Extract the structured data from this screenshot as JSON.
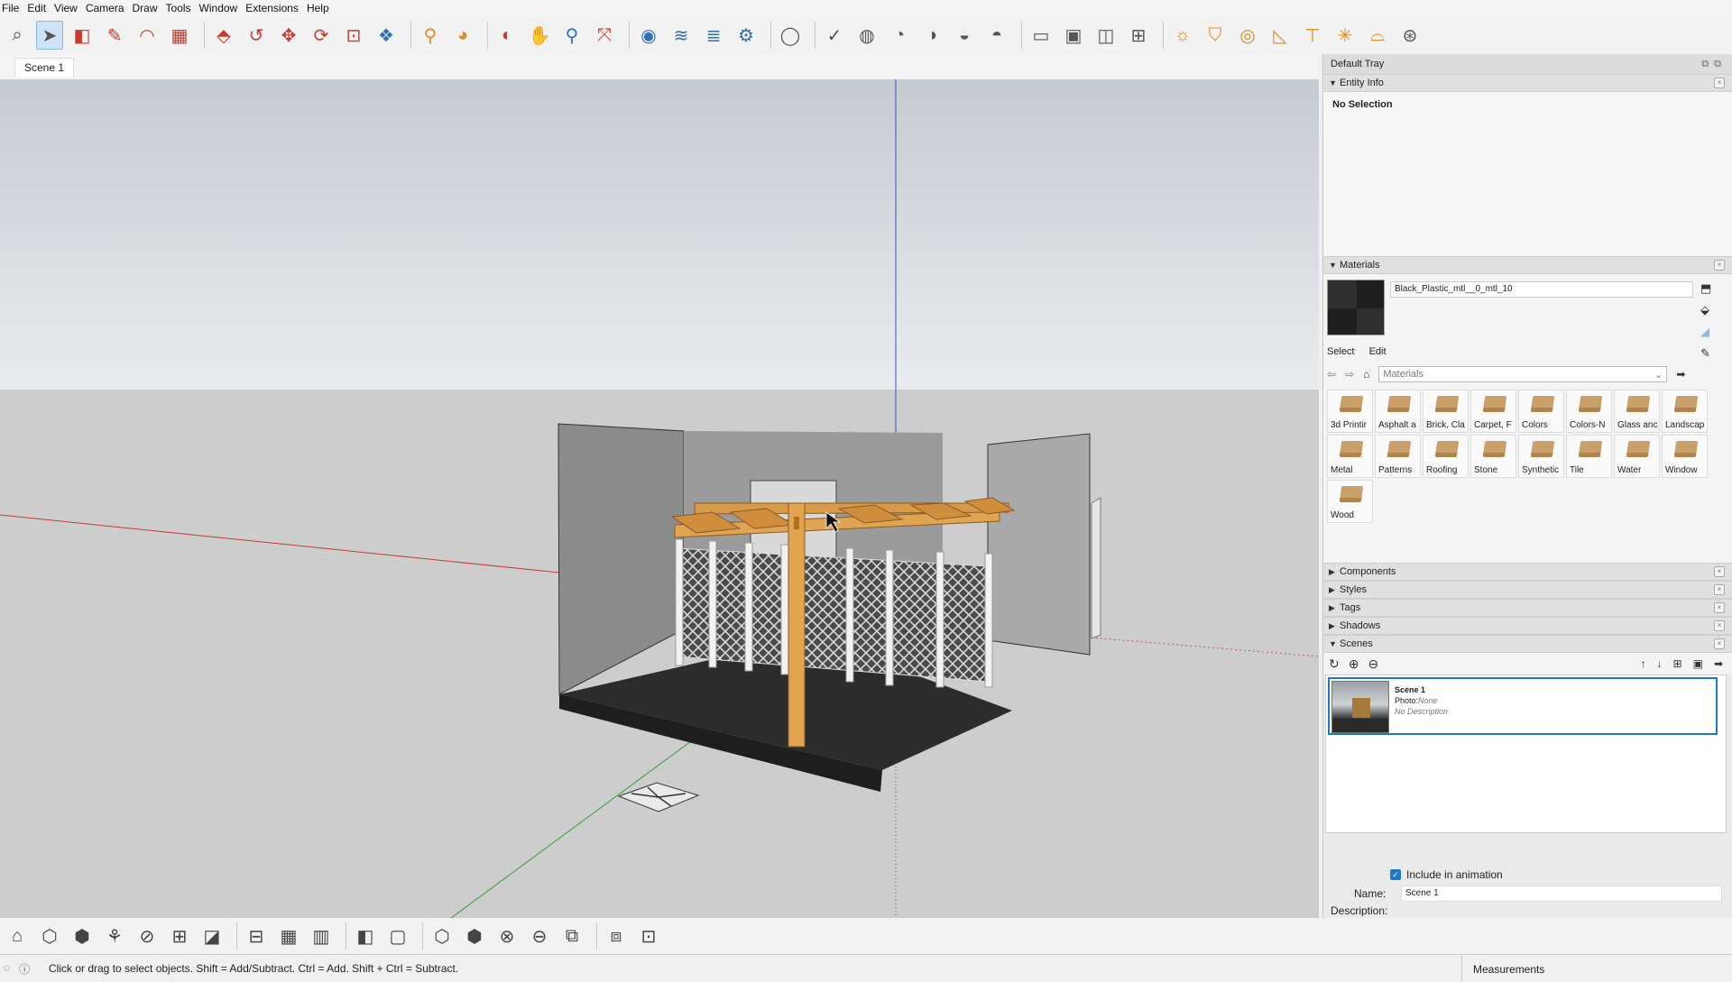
{
  "menu": [
    "File",
    "Edit",
    "View",
    "Camera",
    "Draw",
    "Tools",
    "Window",
    "Extensions",
    "Help"
  ],
  "toolbar": [
    {
      "icon": "search-icon",
      "glyph": "⌕",
      "cls": "c-gray"
    },
    {
      "icon": "select-arrow-icon",
      "glyph": "➤",
      "cls": "c-gray",
      "active": true
    },
    {
      "icon": "eraser-icon",
      "glyph": "◧",
      "cls": "c-red"
    },
    {
      "icon": "pencil-icon",
      "glyph": "✎",
      "cls": "c-red"
    },
    {
      "icon": "arc-icon",
      "glyph": "◠",
      "cls": "c-red"
    },
    {
      "icon": "rectangle-icon",
      "glyph": "▦",
      "cls": "c-red"
    },
    {
      "sep": true
    },
    {
      "icon": "push-pull-icon",
      "glyph": "⬘",
      "cls": "c-red"
    },
    {
      "icon": "follow-me-icon",
      "glyph": "↺",
      "cls": "c-red"
    },
    {
      "icon": "move-icon",
      "glyph": "✥",
      "cls": "c-red"
    },
    {
      "icon": "rotate-icon",
      "glyph": "⟳",
      "cls": "c-red"
    },
    {
      "icon": "scale-icon",
      "glyph": "⊡",
      "cls": "c-red"
    },
    {
      "icon": "offset-icon",
      "glyph": "❖",
      "cls": "c-blue"
    },
    {
      "sep": true
    },
    {
      "icon": "tape-measure-icon",
      "glyph": "⚲",
      "cls": "c-orange"
    },
    {
      "icon": "paint-bucket-icon",
      "glyph": "◕",
      "cls": "c-orange"
    },
    {
      "sep": true
    },
    {
      "icon": "orbit-icon",
      "glyph": "◐",
      "cls": "c-red"
    },
    {
      "icon": "pan-icon",
      "glyph": "✋",
      "cls": "c-orange"
    },
    {
      "icon": "zoom-icon",
      "glyph": "⚲",
      "cls": "c-blue"
    },
    {
      "icon": "zoom-extents-icon",
      "glyph": "⤧",
      "cls": "c-red"
    },
    {
      "sep": true
    },
    {
      "icon": "warehouse-icon",
      "glyph": "◉",
      "cls": "c-blue"
    },
    {
      "icon": "extension-warehouse-icon",
      "glyph": "≋",
      "cls": "c-blue"
    },
    {
      "icon": "layout-icon",
      "glyph": "≣",
      "cls": "c-blue"
    },
    {
      "icon": "extension-manager-icon",
      "glyph": "⚙",
      "cls": "c-blue"
    },
    {
      "sep": true
    },
    {
      "icon": "account-icon",
      "glyph": "◯",
      "cls": "c-gray"
    },
    {
      "sep": true
    },
    {
      "icon": "solid-check-icon",
      "glyph": "✓",
      "cls": "c-gray"
    },
    {
      "icon": "outer-shell-icon",
      "glyph": "◍",
      "cls": "c-gray"
    },
    {
      "icon": "intersect-icon",
      "glyph": "◔",
      "cls": "c-gray"
    },
    {
      "icon": "union-icon",
      "glyph": "◑",
      "cls": "c-gray"
    },
    {
      "icon": "subtract-icon",
      "glyph": "◒",
      "cls": "c-gray"
    },
    {
      "icon": "trim-icon",
      "glyph": "◓",
      "cls": "c-gray"
    },
    {
      "sep": true
    },
    {
      "icon": "section-plane-icon",
      "glyph": "▭",
      "cls": "c-gray"
    },
    {
      "icon": "section-cut-icon",
      "glyph": "▣",
      "cls": "c-gray"
    },
    {
      "icon": "section-fill-icon",
      "glyph": "◫",
      "cls": "c-gray"
    },
    {
      "icon": "section-display-icon",
      "glyph": "⊞",
      "cls": "c-gray"
    },
    {
      "sep": true
    },
    {
      "icon": "sun-shadow-icon",
      "glyph": "☼",
      "cls": "c-orange"
    },
    {
      "icon": "sandbox-icon",
      "glyph": "⛉",
      "cls": "c-orange"
    },
    {
      "icon": "from-contours-icon",
      "glyph": "◎",
      "cls": "c-orange"
    },
    {
      "icon": "from-scratch-icon",
      "glyph": "◺",
      "cls": "c-orange"
    },
    {
      "icon": "smoove-icon",
      "glyph": "⊤",
      "cls": "c-orange"
    },
    {
      "icon": "stamp-icon",
      "glyph": "✳",
      "cls": "c-orange"
    },
    {
      "icon": "drape-icon",
      "glyph": "⌓",
      "cls": "c-orange"
    },
    {
      "icon": "add-detail-icon",
      "glyph": "⊛",
      "cls": "c-gray"
    }
  ],
  "scene_tab": "Scene 1",
  "tray": {
    "title": "Default Tray",
    "entity_info": {
      "header": "Entity Info",
      "body": "No Selection"
    },
    "materials": {
      "header": "Materials",
      "current_name": "Black_Plastic_mtl__0_mtl_10",
      "tab_select": "Select",
      "tab_edit": "Edit",
      "library": "Materials",
      "items": [
        "3d Printir",
        "Asphalt a",
        "Brick, Cla",
        "Carpet, F",
        "Colors",
        "Colors-N",
        "Glass anc",
        "Landscap",
        "Metal",
        "Patterns",
        "Roofing",
        "Stone",
        "Synthetic",
        "Tile",
        "Water",
        "Window",
        "Wood"
      ]
    },
    "collapsed": [
      "Components",
      "Styles",
      "Tags",
      "Shadows"
    ],
    "scenes": {
      "header": "Scenes",
      "card": {
        "name": "Scene 1",
        "photo_label": "Photo:",
        "photo_value": "None",
        "description": "No Description"
      },
      "include_label": "Include in animation",
      "name_label": "Name:",
      "name_value": "Scene 1",
      "description_label": "Description:"
    }
  },
  "bottom_toolbar": [
    "iso-view-icon",
    "top-view-icon",
    "front-view-icon",
    "xray-icon",
    "back-edges-icon",
    "wireframe-icon",
    "hidden-line-icon",
    "shaded-icon",
    "textured-icon",
    "monochrome-icon",
    "xray-toggle-icon",
    "box-icon",
    "iso-box-icon",
    "section-icon",
    "sphere-icon",
    "cylinder-icon",
    "follow-icon",
    "weld-icon",
    "tag-icon"
  ],
  "status": {
    "hint": "Click or drag to select objects. Shift = Add/Subtract. Ctrl = Add. Shift + Ctrl = Subtract.",
    "measurements": "Measurements"
  }
}
